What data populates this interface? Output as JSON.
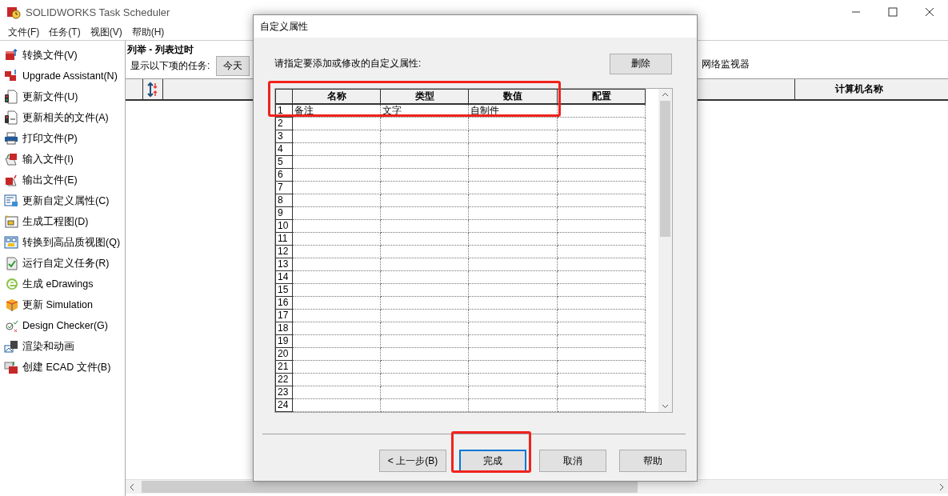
{
  "window": {
    "title": "SOLIDWORKS Task Scheduler"
  },
  "menu": [
    "文件(F)",
    "任务(T)",
    "视图(V)",
    "帮助(H)"
  ],
  "tasks": [
    {
      "label": "转换文件(V)"
    },
    {
      "label": "Upgrade Assistant(N)"
    },
    {
      "label": "更新文件(U)"
    },
    {
      "label": "更新相关的文件(A)"
    },
    {
      "label": "打印文件(P)"
    },
    {
      "label": "输入文件(I)"
    },
    {
      "label": "输出文件(E)"
    },
    {
      "label": "更新自定义属性(C)"
    },
    {
      "label": "生成工程图(D)"
    },
    {
      "label": "转换到高品质视图(Q)"
    },
    {
      "label": "运行自定义任务(R)"
    },
    {
      "label": "生成 eDrawings"
    },
    {
      "label": "更新 Simulation"
    },
    {
      "label": "Design Checker(G)"
    },
    {
      "label": "渲染和动画"
    },
    {
      "label": "创建 ECAD 文件(B)"
    }
  ],
  "list": {
    "heading": "列举 - 列表过时",
    "filter_label": "显示以下项的任务:",
    "filter_value": "今天",
    "monitor": "网络监视器",
    "columns": [
      "计算机名称"
    ]
  },
  "dialog": {
    "title": "自定义属性",
    "instruction": "请指定要添加或修改的自定义属性:",
    "delete_button": "删除",
    "columns": [
      "名称",
      "类型",
      "数值",
      "配置"
    ],
    "rows": [
      {
        "number": "1",
        "name": "备注",
        "type": "文字",
        "value": "自制件"
      },
      {
        "number": "2"
      },
      {
        "number": "3"
      },
      {
        "number": "4"
      },
      {
        "number": "5"
      },
      {
        "number": "6"
      },
      {
        "number": "7"
      },
      {
        "number": "8"
      },
      {
        "number": "9"
      },
      {
        "number": "10"
      },
      {
        "number": "11"
      },
      {
        "number": "12"
      },
      {
        "number": "13"
      },
      {
        "number": "14"
      },
      {
        "number": "15"
      },
      {
        "number": "16"
      },
      {
        "number": "17"
      },
      {
        "number": "18"
      },
      {
        "number": "19"
      },
      {
        "number": "20"
      },
      {
        "number": "21"
      },
      {
        "number": "22"
      },
      {
        "number": "23"
      },
      {
        "number": "24"
      }
    ],
    "buttons": [
      {
        "label": "< 上一步(B)",
        "default": false
      },
      {
        "label": "完成",
        "default": true
      },
      {
        "label": "取消",
        "default": false
      },
      {
        "label": "帮助",
        "default": false
      }
    ]
  }
}
